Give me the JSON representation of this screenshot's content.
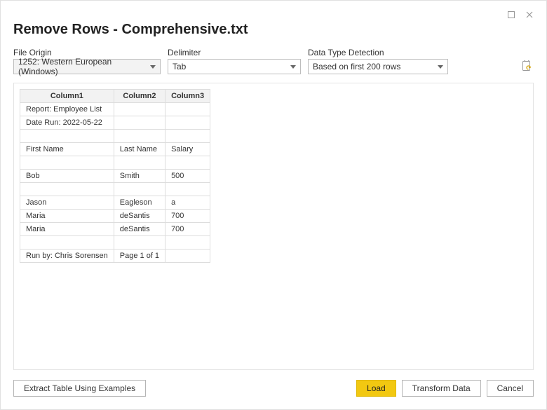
{
  "title": "Remove Rows - Comprehensive.txt",
  "options": {
    "file_origin": {
      "label": "File Origin",
      "value": "1252: Western European (Windows)"
    },
    "delimiter": {
      "label": "Delimiter",
      "value": "Tab"
    },
    "data_type": {
      "label": "Data Type Detection",
      "value": "Based on first 200 rows"
    }
  },
  "table": {
    "headers": [
      "Column1",
      "Column2",
      "Column3"
    ],
    "rows": [
      [
        "Report: Employee List",
        "",
        ""
      ],
      [
        "Date Run: 2022-05-22",
        "",
        ""
      ],
      [
        "",
        "",
        ""
      ],
      [
        "First Name",
        "Last Name",
        "Salary"
      ],
      [
        "",
        "",
        ""
      ],
      [
        "Bob",
        "Smith",
        "500"
      ],
      [
        "",
        "",
        ""
      ],
      [
        "Jason",
        "Eagleson",
        "a"
      ],
      [
        "Maria",
        "deSantis",
        "700"
      ],
      [
        "Maria",
        "deSantis",
        "700"
      ],
      [
        "",
        "",
        ""
      ],
      [
        "Run by: Chris Sorensen",
        "Page 1 of 1",
        ""
      ]
    ]
  },
  "buttons": {
    "extract": "Extract Table Using Examples",
    "load": "Load",
    "transform": "Transform Data",
    "cancel": "Cancel"
  }
}
